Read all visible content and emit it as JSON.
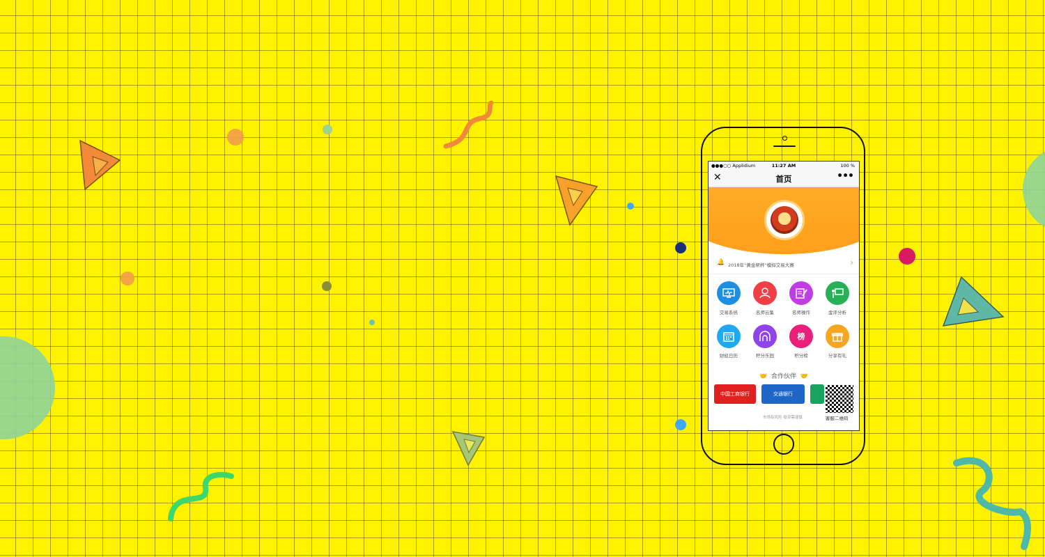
{
  "status_bar": {
    "carrier": "●●●○○ Applidium",
    "time": "11:27 AM",
    "battery": "100 %"
  },
  "nav": {
    "title": "首页",
    "close_glyph": "✕",
    "more_glyph": "•••"
  },
  "notice": {
    "text": "2018年“黄金帮杯”模拟交易大赛"
  },
  "menu": [
    {
      "label": "交易系统",
      "color": "#1e8fe0",
      "icon": "monitor-icon",
      "glyph": "▭"
    },
    {
      "label": "名师云集",
      "color": "#ef3e44",
      "icon": "teacher-icon",
      "glyph": "☺"
    },
    {
      "label": "名师操作",
      "color": "#c03de6",
      "icon": "edit-icon",
      "glyph": "✎"
    },
    {
      "label": "金评分析",
      "color": "#27b058",
      "icon": "presentation-icon",
      "glyph": "▤"
    },
    {
      "label": "财经日历",
      "color": "#1ea9f0",
      "icon": "calendar-icon",
      "glyph": "▦"
    },
    {
      "label": "积分乐园",
      "color": "#8e44e8",
      "icon": "park-icon",
      "glyph": "⌂"
    },
    {
      "label": "积分榜",
      "color": "#e8207a",
      "icon": "rank-icon",
      "glyph": "榜"
    },
    {
      "label": "分享有礼",
      "color": "#f6a623",
      "icon": "gift-icon",
      "glyph": "▣"
    }
  ],
  "partners": {
    "title": "合作伙伴",
    "banks": [
      {
        "name": "中国工商银行",
        "color": "#e0201f"
      },
      {
        "name": "交通银行",
        "color": "#1f66c9"
      },
      {
        "name": "",
        "color": "#18a35f"
      }
    ],
    "risk_note": "市场有风险 投资需谨慎",
    "qr_label": "客服二维码"
  },
  "colors": {
    "background": "#fff200",
    "banner_orange": "#ffa01f"
  }
}
